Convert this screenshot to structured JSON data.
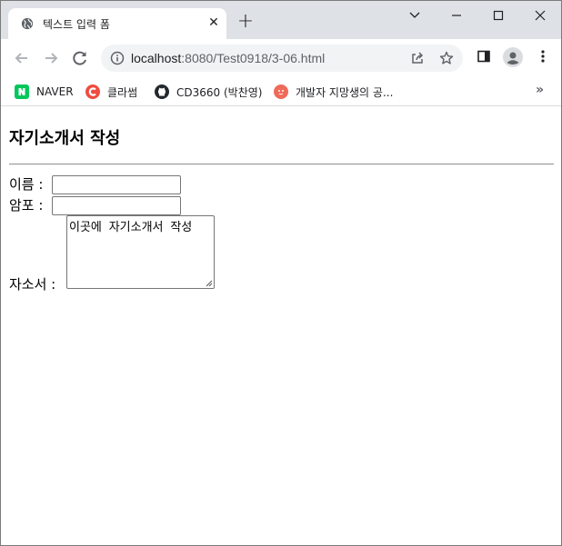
{
  "browser": {
    "tab": {
      "title": "텍스트 입력 폼",
      "close_glyph": "✕"
    },
    "new_tab_glyph": "+",
    "address": {
      "host": "localhost",
      "path": ":8080/Test0918/3-06.html"
    },
    "bookmarks": [
      {
        "label": "NAVER",
        "icon": "naver-icon",
        "color": "#03c75a"
      },
      {
        "label": "클라썸",
        "icon": "classum-icon",
        "color": "#ef4b3f"
      },
      {
        "label": "CD3660 (박찬영)",
        "icon": "github-icon",
        "color": "#24292f"
      },
      {
        "label": "개발자 지망생의 공...",
        "icon": "blog-icon",
        "color": "#f06a5a"
      }
    ],
    "bookmarks_more_glyph": "»"
  },
  "page": {
    "heading": "자기소개서 작성",
    "fields": {
      "name_label": "이름 :",
      "password_label": "암포 :",
      "intro_label": "자소서 :",
      "intro_value": "이곳에 자기소개서 작성"
    }
  },
  "colors": {
    "tabstrip_bg": "#dee1e6",
    "omnibox_bg": "#f1f3f4",
    "border": "#767676"
  }
}
